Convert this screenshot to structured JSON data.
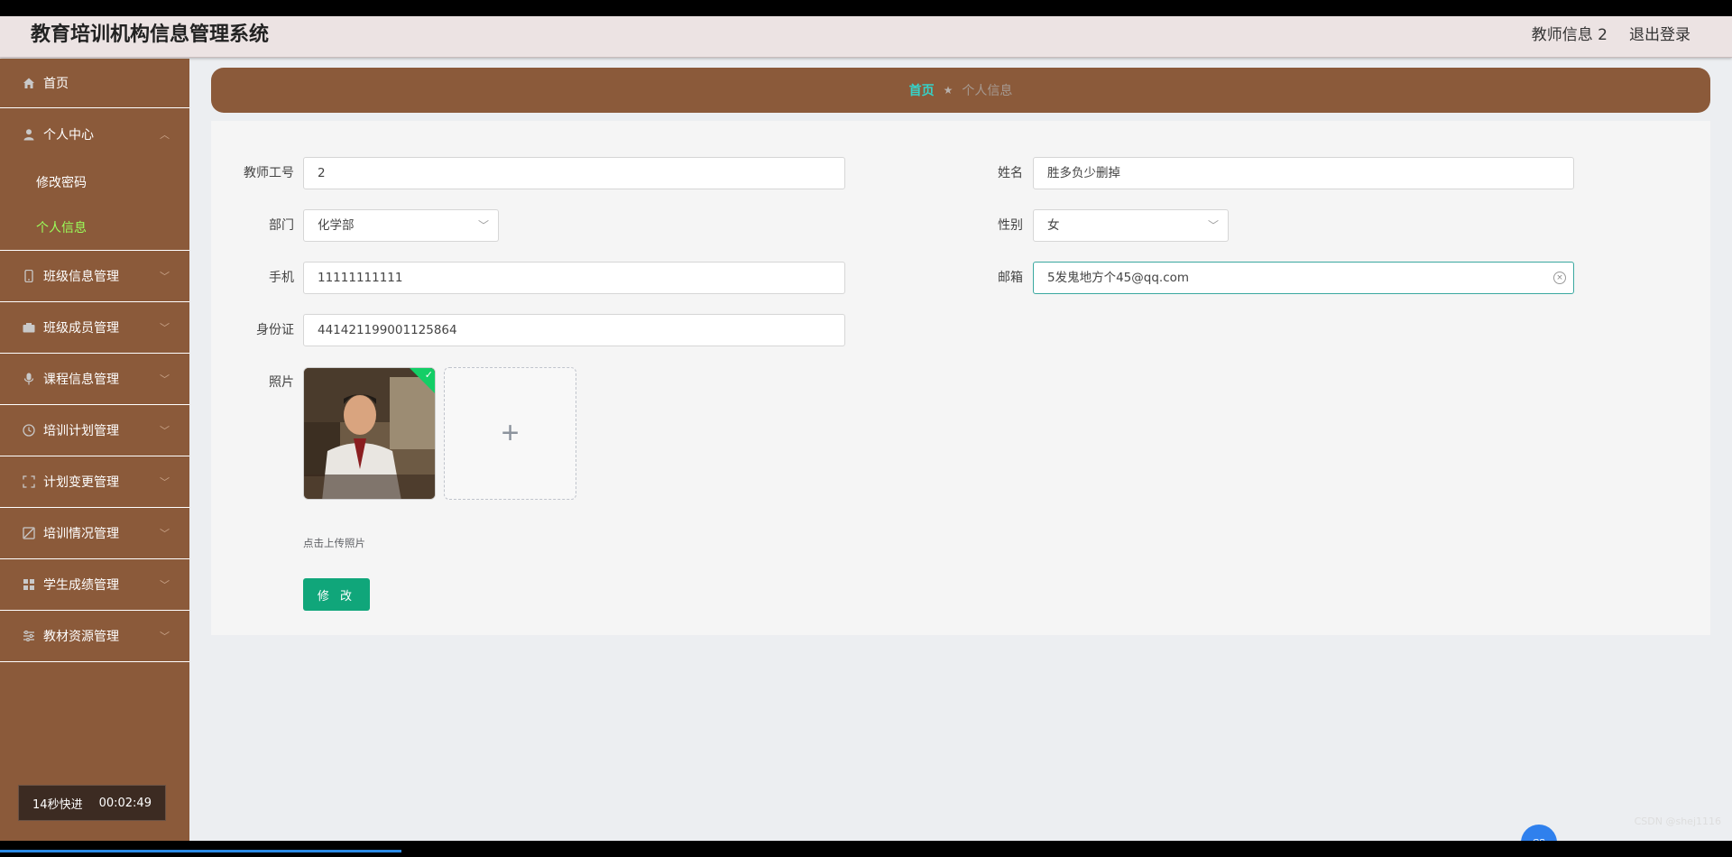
{
  "header": {
    "title": "教育培训机构信息管理系统",
    "user_label": "教师信息 2",
    "logout_label": "退出登录"
  },
  "sidebar": {
    "items": [
      {
        "label": "首页",
        "icon": "home-icon"
      },
      {
        "label": "个人中心",
        "icon": "user-icon",
        "expanded": true,
        "children": [
          {
            "label": "修改密码",
            "active": false
          },
          {
            "label": "个人信息",
            "active": true
          }
        ]
      },
      {
        "label": "班级信息管理",
        "icon": "phone-icon"
      },
      {
        "label": "班级成员管理",
        "icon": "camera-icon"
      },
      {
        "label": "课程信息管理",
        "icon": "microphone-icon"
      },
      {
        "label": "培训计划管理",
        "icon": "clock-icon"
      },
      {
        "label": "计划变更管理",
        "icon": "fullscreen-icon"
      },
      {
        "label": "培训情况管理",
        "icon": "slash-icon"
      },
      {
        "label": "学生成绩管理",
        "icon": "grid-icon"
      },
      {
        "label": "教材资源管理",
        "icon": "sliders-icon"
      }
    ],
    "video_overlay": {
      "speed": "14秒快进",
      "time": "00:02:49"
    }
  },
  "breadcrumb": {
    "home": "首页",
    "separator": "★",
    "current": "个人信息"
  },
  "form": {
    "teacher_id": {
      "label": "教师工号",
      "value": "2"
    },
    "name": {
      "label": "姓名",
      "value": "胜多负少删掉"
    },
    "department": {
      "label": "部门",
      "value": "化学部"
    },
    "gender": {
      "label": "性别",
      "value": "女"
    },
    "phone": {
      "label": "手机",
      "value": "11111111111"
    },
    "email": {
      "label": "邮箱",
      "value": "5发鬼地方个45@qq.com"
    },
    "id_card": {
      "label": "身份证",
      "value": "441421199001125864"
    },
    "photo": {
      "label": "照片",
      "upload_tip": "点击上传照片",
      "add_symbol": "+"
    },
    "submit_label": "修 改"
  },
  "tray": {
    "watermark": "CSDN @shej1116",
    "ime_badge": "CS"
  },
  "colors": {
    "sidebar": "#8b5a3a",
    "accent": "#10a67a",
    "active_menu": "#9bff5a",
    "breadcrumb_home": "#35d2c8"
  }
}
